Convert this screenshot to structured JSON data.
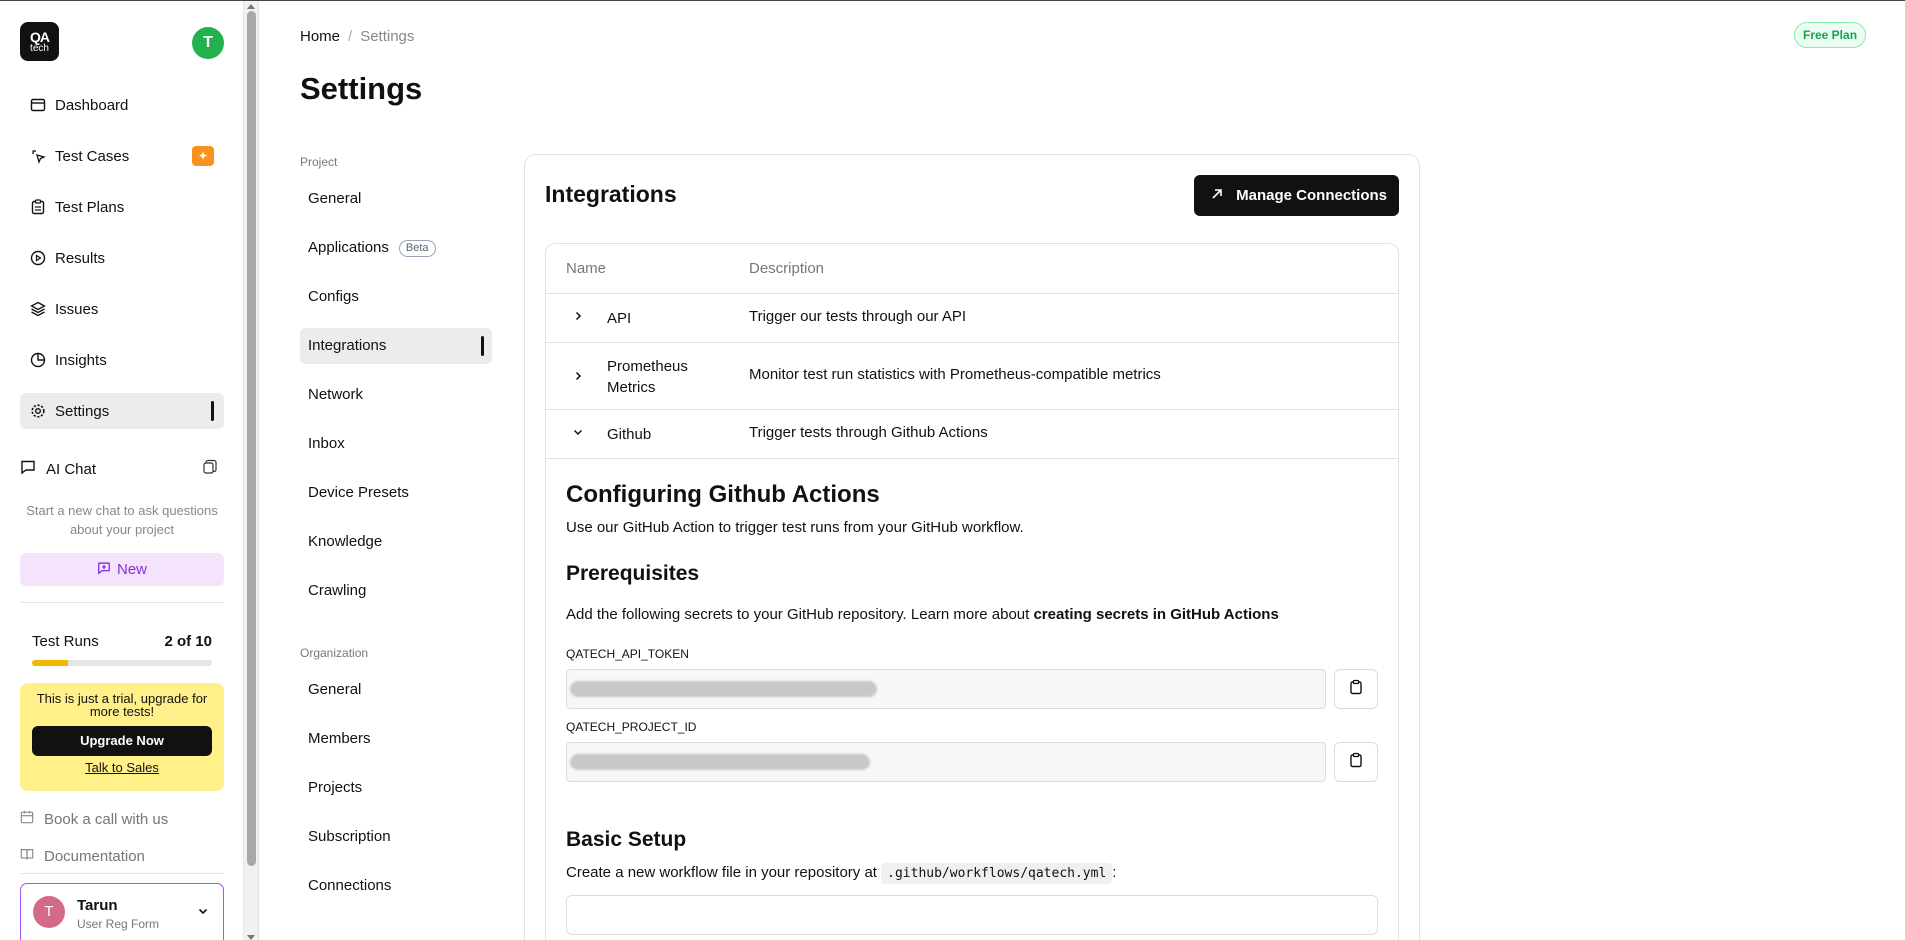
{
  "sidebar": {
    "logo_line1": "QA",
    "logo_line2": "tech",
    "avatar_initial": "T",
    "nav": [
      {
        "label": "Dashboard",
        "icon": "dashboard-icon"
      },
      {
        "label": "Test Cases",
        "icon": "test-cases-icon"
      },
      {
        "label": "Test Plans",
        "icon": "clipboard-icon"
      },
      {
        "label": "Results",
        "icon": "play-circle-icon"
      },
      {
        "label": "Issues",
        "icon": "layers-icon"
      },
      {
        "label": "Insights",
        "icon": "pie-chart-icon"
      },
      {
        "label": "Settings",
        "icon": "gear-icon"
      }
    ],
    "ai_chat": {
      "label": "AI Chat",
      "hint": "Start a new chat to ask questions about your project",
      "new_label": "New"
    },
    "test_runs": {
      "label": "Test Runs",
      "count": "2 of 10",
      "progress": 0.2
    },
    "upgrade": {
      "message": "This is just a trial, upgrade for more tests!",
      "button": "Upgrade Now",
      "link": "Talk to Sales"
    },
    "links": {
      "book_call": "Book a call with us",
      "documentation": "Documentation"
    },
    "user": {
      "initial": "T",
      "name": "Tarun",
      "subtitle": "User Reg Form"
    }
  },
  "header": {
    "breadcrumb_home": "Home",
    "breadcrumb_sep": "/",
    "breadcrumb_current": "Settings",
    "plan_badge": "Free Plan",
    "title": "Settings"
  },
  "settings_nav": {
    "project_group": "Project",
    "project_items": [
      "General",
      "Applications",
      "Configs",
      "Integrations",
      "Network",
      "Inbox",
      "Device Presets",
      "Knowledge",
      "Crawling"
    ],
    "beta_label": "Beta",
    "org_group": "Organization",
    "org_items": [
      "General",
      "Members",
      "Projects",
      "Subscription",
      "Connections"
    ]
  },
  "integrations": {
    "title": "Integrations",
    "manage_button": "Manage Connections",
    "col_name": "Name",
    "col_description": "Description",
    "rows": [
      {
        "name": "API",
        "description": "Trigger our tests through our API"
      },
      {
        "name": "Prometheus Metrics",
        "description": "Monitor test run statistics with Prometheus-compatible metrics"
      },
      {
        "name": "Github",
        "description": "Trigger tests through Github Actions"
      }
    ],
    "github": {
      "heading": "Configuring Github Actions",
      "intro": "Use our GitHub Action to trigger test runs from your GitHub workflow.",
      "prereq_heading": "Prerequisites",
      "prereq_text": "Add the following secrets to your GitHub repository. Learn more about",
      "prereq_link": "creating secrets in GitHub Actions",
      "secret1_label": "QATECH_API_TOKEN",
      "secret2_label": "QATECH_PROJECT_ID",
      "basic_heading": "Basic Setup",
      "basic_text": "Create a new workflow file in your repository at",
      "basic_path": ".github/workflows/qatech.yml",
      "basic_colon": ":"
    }
  }
}
